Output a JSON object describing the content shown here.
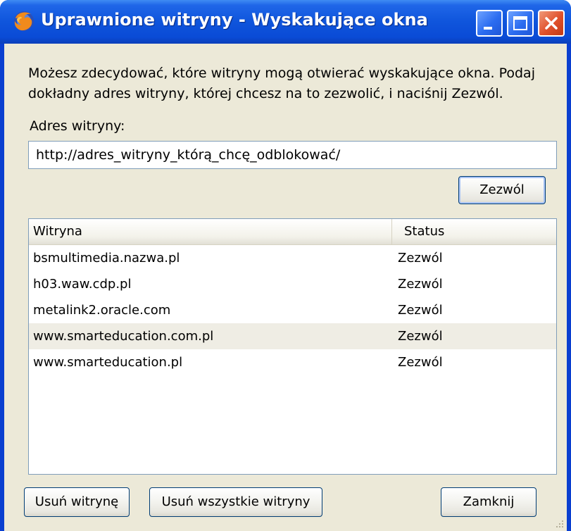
{
  "window": {
    "title": "Uprawnione witryny - Wyskakujące okna",
    "icon": "firefox-icon",
    "controls": [
      "minimize-icon",
      "maximize-icon",
      "close-icon"
    ],
    "colors": {
      "titlebar": "#0a4bd6",
      "client": "#ece9d8",
      "close_button": "#e0502a"
    }
  },
  "content": {
    "description": "Możesz zdecydować, które witryny mogą otwierać wyskakujące okna. Podaj\ndokładny adres witryny, której chcesz na to zezwolić, i naciśnij Zezwól.",
    "address_label": "Adres witryny:",
    "address_value": "http://adres_witryny_którą_chcę_odblokować/",
    "allow_button": "Zezwól"
  },
  "list": {
    "headers": {
      "site": "Witryna",
      "status": "Status"
    },
    "rows": [
      {
        "site": "bsmultimedia.nazwa.pl",
        "status": "Zezwól"
      },
      {
        "site": "h03.waw.cdp.pl",
        "status": "Zezwól"
      },
      {
        "site": "metalink2.oracle.com",
        "status": "Zezwól"
      },
      {
        "site": "www.smarteducation.com.pl",
        "status": "Zezwól"
      },
      {
        "site": "www.smarteducation.pl",
        "status": "Zezwól"
      }
    ],
    "selected_index": 3
  },
  "footer": {
    "remove_button": "Usuń witrynę",
    "remove_all_button": "Usuń wszystkie witryny",
    "close_button": "Zamknij"
  }
}
